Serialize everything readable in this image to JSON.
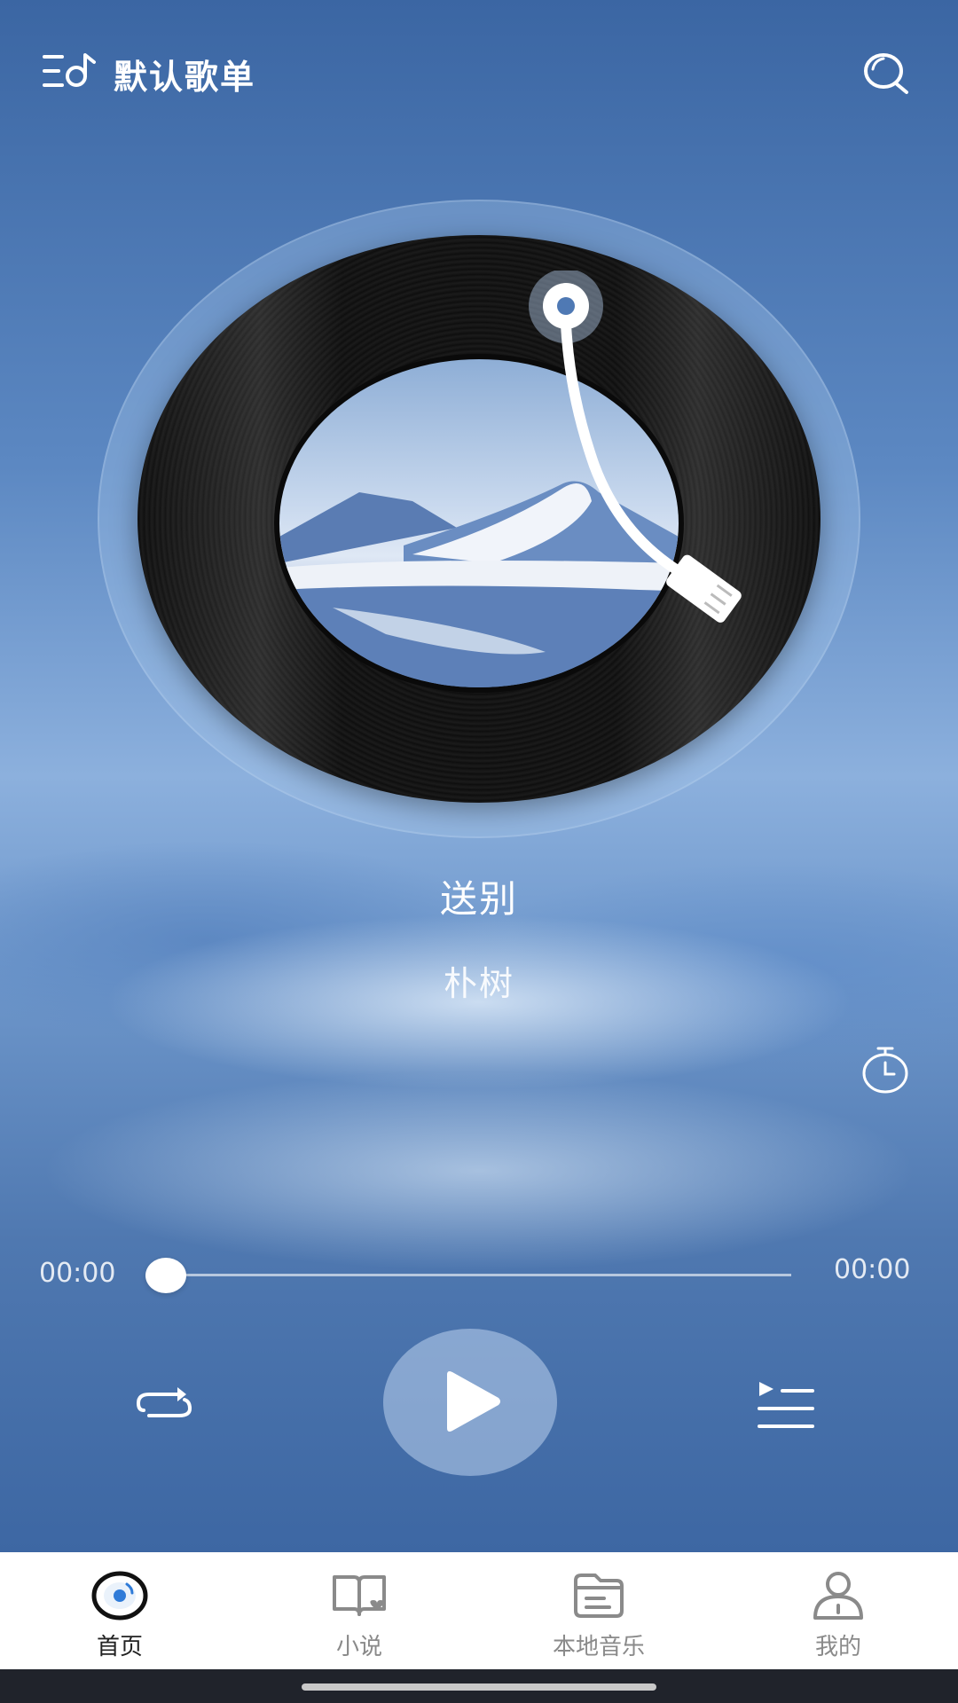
{
  "header": {
    "playlist_title": "默认歌单"
  },
  "song": {
    "title": "送别",
    "artist": "朴树"
  },
  "progress": {
    "current_time": "00:00",
    "total_time": "00:00",
    "fraction": 0.0
  },
  "player": {
    "state": "paused"
  },
  "nav": {
    "items": [
      {
        "label": "首页",
        "icon": "vinyl-icon",
        "active": true
      },
      {
        "label": "小说",
        "icon": "book-icon",
        "active": false
      },
      {
        "label": "本地音乐",
        "icon": "folder-icon",
        "active": false
      },
      {
        "label": "我的",
        "icon": "person-icon",
        "active": false
      }
    ]
  },
  "colors": {
    "accent": "#2f7bd8",
    "nav_text": "#8a8a8a",
    "nav_text_active": "#222222"
  }
}
